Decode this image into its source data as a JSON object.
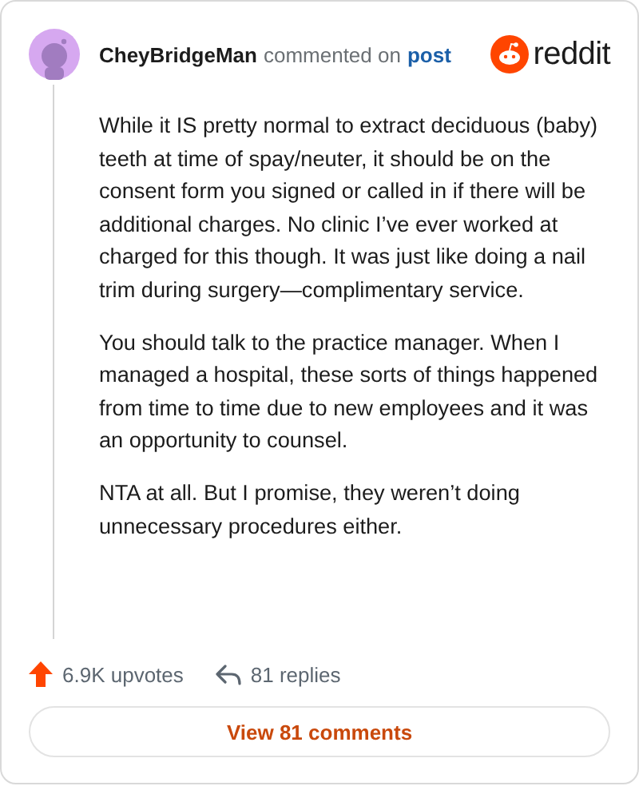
{
  "header": {
    "author": "CheyBridgeMan",
    "action": "commented on",
    "link": "post",
    "brand": "reddit"
  },
  "paragraphs": [
    "While it IS pretty normal to extract deciduous (baby) teeth at time of spay/neuter, it should be on the consent form you signed or called in if there will be additional charges. No clinic I’ve ever worked at charged for this though. It was just like doing a nail trim during surgery—complimentary service.",
    "You should talk to the practice manager. When I managed a hospital, these sorts of things happened from time to time due to new employees and it was an opportunity to counsel.",
    "NTA at all. But I promise, they weren’t doing unnecessary procedures either."
  ],
  "footer": {
    "upvotes": "6.9K upvotes",
    "replies": "81 replies",
    "button": "View 81 comments"
  }
}
